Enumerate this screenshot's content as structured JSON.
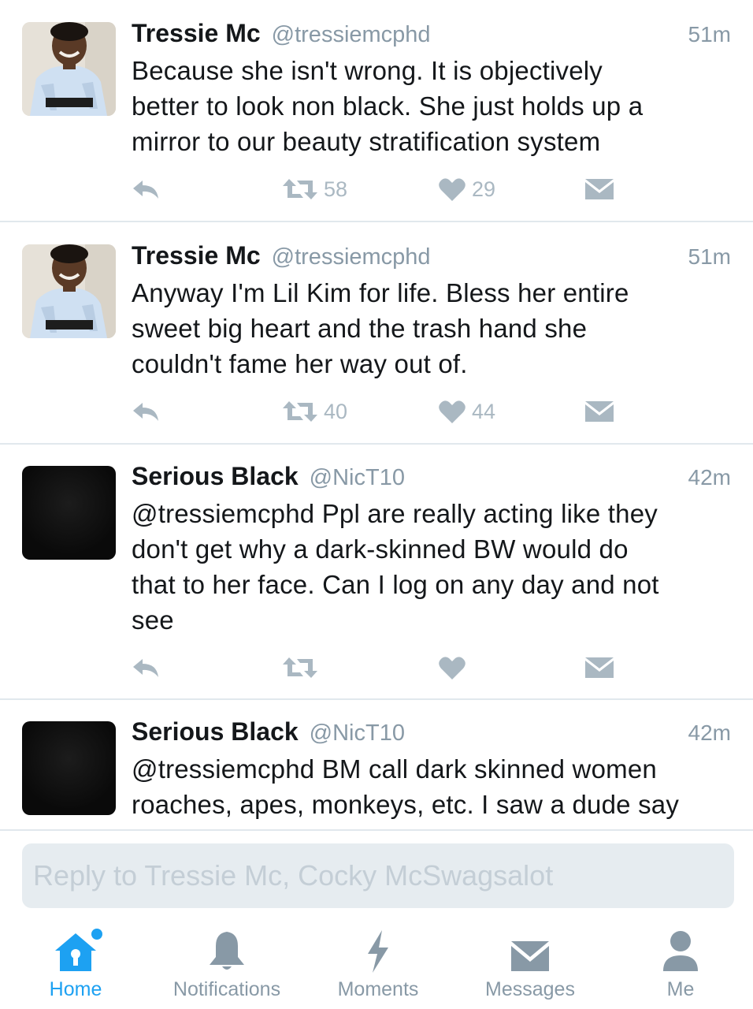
{
  "tweets": [
    {
      "name": "Tressie Mc",
      "handle": "@tressiemcphd",
      "time": "51m",
      "avatar": "profile-photo-woman",
      "text_lines": [
        "Because she isn't wrong. It is objectively",
        "better to look non black. She just holds up a",
        "mirror to our beauty stratification system"
      ],
      "retweets": "58",
      "likes": "29"
    },
    {
      "name": "Tressie Mc",
      "handle": "@tressiemcphd",
      "time": "51m",
      "avatar": "profile-photo-woman",
      "text_lines": [
        "Anyway I'm Lil Kim for life. Bless her entire",
        "sweet big heart and the trash hand she",
        "couldn't fame her way out of."
      ],
      "retweets": "40",
      "likes": "44"
    },
    {
      "name": "Serious Black",
      "handle": "@NicT10",
      "time": "42m",
      "avatar": "black-square",
      "text_lines": [
        "@tressiemcphd Ppl are really acting like they",
        "don't get why a dark-skinned BW would do",
        "that to her face. Can I log on any day and not",
        "see"
      ],
      "retweets": "",
      "likes": ""
    },
    {
      "name": "Serious Black",
      "handle": "@NicT10",
      "time": "42m",
      "avatar": "black-square",
      "text_lines": [
        "@tressiemcphd BM call dark skinned women",
        "roaches, apes, monkeys, etc. I saw a dude say"
      ],
      "retweets": "",
      "likes": ""
    }
  ],
  "reply": {
    "placeholder": "Reply to Tressie Mc, Cocky McSwagsalot"
  },
  "tabbar": {
    "tabs": [
      {
        "label": "Home",
        "icon": "home-icon",
        "active": true,
        "has_dot": true
      },
      {
        "label": "Notifications",
        "icon": "bell-icon",
        "active": false
      },
      {
        "label": "Moments",
        "icon": "lightning-icon",
        "active": false
      },
      {
        "label": "Messages",
        "icon": "envelope-icon",
        "active": false
      },
      {
        "label": "Me",
        "icon": "person-icon",
        "active": false
      }
    ]
  },
  "colors": {
    "accent": "#1da1f2",
    "muted": "#8899a6",
    "action_gray": "#aab8c2",
    "divider": "#e1e8ed",
    "reply_bg": "#e6ecf0"
  }
}
